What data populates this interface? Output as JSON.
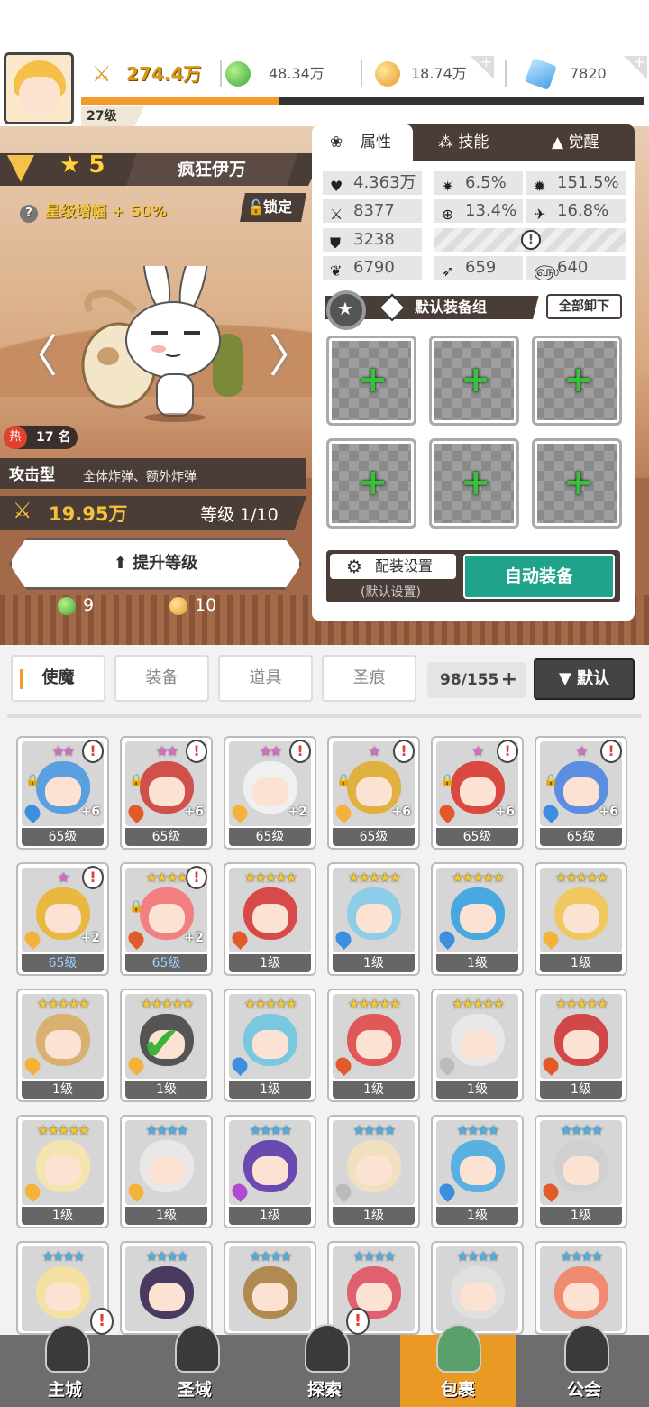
{
  "player": {
    "level": "27级",
    "power": "274.4万"
  },
  "resources": {
    "green_gem": "48.34万",
    "gold_coin": "18.74万",
    "blue_crystal": "7820"
  },
  "hero": {
    "stars": "5",
    "name": "疯狂伊万",
    "boost": "星级增幅 + 50%",
    "lock_label": "锁定",
    "rank_label": "17 名",
    "hot_icon": "热",
    "type": "攻击型",
    "type_desc": "全体炸弹、额外炸弹",
    "power": "19.95万",
    "level": "等级 1/10",
    "upgrade_label": "提升等级",
    "cost_green": "9",
    "cost_gold": "10",
    "prev_arrow": "〈",
    "next_arrow": "〉"
  },
  "panel": {
    "tabs": [
      "属性",
      "技能",
      "觉醒"
    ],
    "stats": {
      "hp": "4.363万",
      "crit": "6.5%",
      "crit_dmg": "151.5%",
      "atk": "8377",
      "accuracy": "13.4%",
      "dodge": "16.8%",
      "def": "3238",
      "stat_a": "6790",
      "stat_b": "659",
      "stat_c": "640"
    },
    "equip_group": "默认装备组",
    "unequip_all": "全部卸下",
    "config_label": "配装设置",
    "config_sub": "(默认设置)",
    "auto_equip": "自动装备"
  },
  "inventory": {
    "tabs": [
      "使魔",
      "装备",
      "道具",
      "圣痕"
    ],
    "capacity": "98/155",
    "sort_label": "▼ 默认",
    "cards": [
      {
        "stars": "★★",
        "star_color": "#e066c8",
        "level": "65级",
        "plus": "+6",
        "alert": true,
        "lock": true,
        "color": "#5aa0e0",
        "elem": "#3b8ee0"
      },
      {
        "stars": "★★",
        "star_color": "#e066c8",
        "level": "65级",
        "plus": "+6",
        "alert": true,
        "lock": true,
        "color": "#d0504c",
        "elem": "#e05a2a"
      },
      {
        "stars": "★★",
        "star_color": "#e066c8",
        "level": "65级",
        "plus": "+2",
        "alert": true,
        "lock": false,
        "color": "#f0f0f0",
        "elem": "#f4b23a"
      },
      {
        "stars": "★",
        "star_color": "#e066c8",
        "level": "65级",
        "plus": "+6",
        "alert": true,
        "lock": true,
        "color": "#e0b040",
        "elem": "#f4b23a"
      },
      {
        "stars": "★",
        "star_color": "#e066c8",
        "level": "65级",
        "plus": "+6",
        "alert": true,
        "lock": true,
        "color": "#d84a40",
        "elem": "#e05a2a"
      },
      {
        "stars": "★",
        "star_color": "#e066c8",
        "level": "65级",
        "plus": "+6",
        "alert": true,
        "lock": true,
        "color": "#5b8ee0",
        "elem": "#3b8ee0"
      },
      {
        "stars": "★",
        "star_color": "#e066c8",
        "level": "65级",
        "plus": "+2",
        "alert": true,
        "lock": false,
        "color": "#e8b840",
        "elem": "#f4b23a",
        "blue": true
      },
      {
        "stars": "★★★★",
        "star_color": "#f2c833",
        "level": "65级",
        "plus": "+2",
        "alert": true,
        "lock": true,
        "color": "#f28080",
        "elem": "#e05a2a",
        "blue": true
      },
      {
        "stars": "★★★★★",
        "star_color": "#f2c833",
        "level": "1级",
        "plus": "",
        "alert": false,
        "lock": false,
        "color": "#d84a4a",
        "elem": "#e05a2a"
      },
      {
        "stars": "★★★★★",
        "star_color": "#f2c833",
        "level": "1级",
        "plus": "",
        "alert": false,
        "lock": false,
        "color": "#8ecde8",
        "elem": "#3b8ee0"
      },
      {
        "stars": "★★★★★",
        "star_color": "#f2c833",
        "level": "1级",
        "plus": "",
        "alert": false,
        "lock": false,
        "color": "#4aa8e0",
        "elem": "#3b8ee0"
      },
      {
        "stars": "★★★★★",
        "star_color": "#f2c833",
        "level": "1级",
        "plus": "",
        "alert": false,
        "lock": false,
        "color": "#f0c860",
        "elem": "#f4b23a"
      },
      {
        "stars": "★★★★★",
        "star_color": "#f2c833",
        "level": "1级",
        "plus": "",
        "alert": false,
        "lock": false,
        "color": "#d8b070",
        "elem": "#f4b23a"
      },
      {
        "stars": "★★★★★",
        "star_color": "#f2c833",
        "level": "1级",
        "plus": "",
        "alert": false,
        "lock": false,
        "color": "#555555",
        "elem": "#f4b23a",
        "check": true
      },
      {
        "stars": "★★★★★",
        "star_color": "#f2c833",
        "level": "1级",
        "plus": "",
        "alert": false,
        "lock": false,
        "color": "#7ac8e0",
        "elem": "#3b8ee0"
      },
      {
        "stars": "★★★★★",
        "star_color": "#f2c833",
        "level": "1级",
        "plus": "",
        "alert": false,
        "lock": false,
        "color": "#e05858",
        "elem": "#e05a2a"
      },
      {
        "stars": "★★★★★",
        "star_color": "#f2c833",
        "level": "1级",
        "plus": "",
        "alert": false,
        "lock": false,
        "color": "#e8e8e8",
        "elem": "#bbbbbb"
      },
      {
        "stars": "★★★★★",
        "star_color": "#f2c833",
        "level": "1级",
        "plus": "",
        "alert": false,
        "lock": false,
        "color": "#d04848",
        "elem": "#e05a2a"
      },
      {
        "stars": "★★★★★",
        "star_color": "#f2c833",
        "level": "1级",
        "plus": "",
        "alert": false,
        "lock": false,
        "color": "#f4e4b0",
        "elem": "#f4b23a"
      },
      {
        "stars": "★★★★",
        "star_color": "#4ab0e8",
        "level": "1级",
        "plus": "",
        "alert": false,
        "lock": false,
        "color": "#e8e8e8",
        "elem": "#f4b23a"
      },
      {
        "stars": "★★★★",
        "star_color": "#4ab0e8",
        "level": "1级",
        "plus": "",
        "alert": false,
        "lock": false,
        "color": "#6a4ab0",
        "elem": "#b04ad0"
      },
      {
        "stars": "★★★★",
        "star_color": "#4ab0e8",
        "level": "1级",
        "plus": "",
        "alert": false,
        "lock": false,
        "color": "#f0e0c0",
        "elem": "#bbbbbb"
      },
      {
        "stars": "★★★★",
        "star_color": "#4ab0e8",
        "level": "1级",
        "plus": "",
        "alert": false,
        "lock": false,
        "color": "#5ab0e0",
        "elem": "#3b8ee0"
      },
      {
        "stars": "★★★★",
        "star_color": "#4ab0e8",
        "level": "1级",
        "plus": "",
        "alert": false,
        "lock": false,
        "color": "#d0d0d0",
        "elem": "#e05a2a"
      },
      {
        "stars": "★★★★",
        "star_color": "#4ab0e8",
        "level": "",
        "plus": "",
        "alert": false,
        "lock": false,
        "color": "#f4e0a0",
        "elem": ""
      },
      {
        "stars": "★★★★",
        "star_color": "#4ab0e8",
        "level": "",
        "plus": "",
        "alert": false,
        "lock": false,
        "color": "#4a3a60",
        "elem": ""
      },
      {
        "stars": "★★★★",
        "star_color": "#4ab0e8",
        "level": "",
        "plus": "",
        "alert": false,
        "lock": false,
        "color": "#b08a50",
        "elem": ""
      },
      {
        "stars": "★★★★",
        "star_color": "#4ab0e8",
        "level": "",
        "plus": "",
        "alert": false,
        "lock": false,
        "color": "#e06070",
        "elem": ""
      },
      {
        "stars": "★★★★",
        "star_color": "#4ab0e8",
        "level": "",
        "plus": "",
        "alert": false,
        "lock": false,
        "color": "#e0e0e0",
        "elem": ""
      },
      {
        "stars": "★★★★",
        "star_color": "#4ab0e8",
        "level": "",
        "plus": "",
        "alert": false,
        "lock": false,
        "color": "#f08a70",
        "elem": ""
      }
    ]
  },
  "nav": {
    "items": [
      "主城",
      "圣域",
      "探索",
      "包裹",
      "公会"
    ],
    "active": "包裹"
  }
}
